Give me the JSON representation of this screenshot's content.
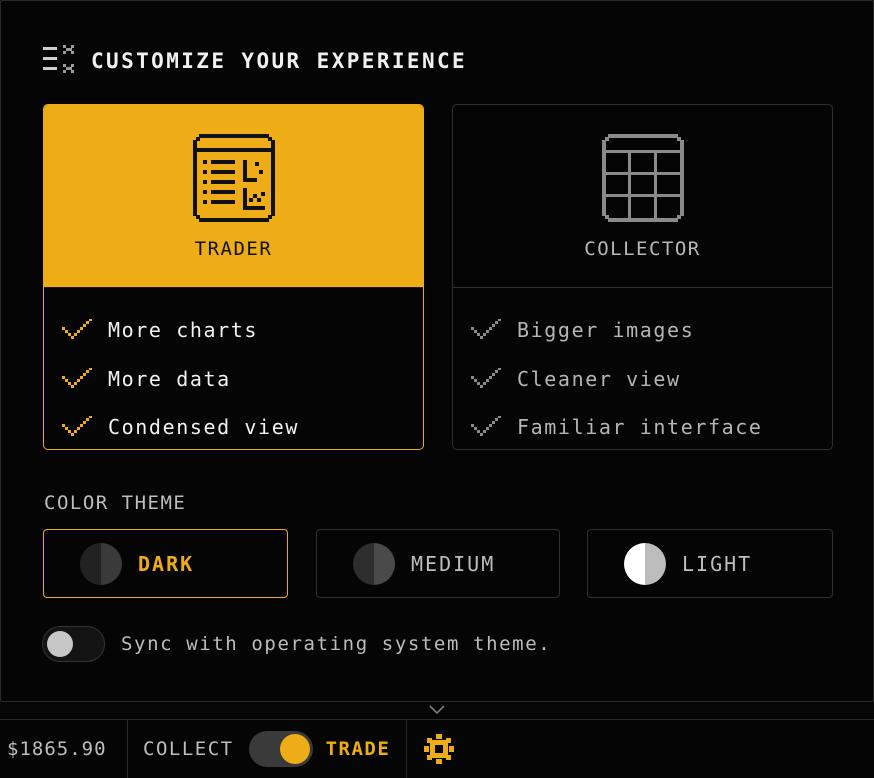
{
  "panel": {
    "title": "CUSTOMIZE YOUR EXPERIENCE",
    "title_icon": "customize-icon"
  },
  "modes": [
    {
      "label": "TRADER",
      "selected": true,
      "icon": "trader-dashboard-icon",
      "features": [
        "More charts",
        "More data",
        "Condensed view"
      ]
    },
    {
      "label": "COLLECTOR",
      "selected": false,
      "icon": "collector-grid-icon",
      "features": [
        "Bigger images",
        "Cleaner view",
        "Familiar interface"
      ]
    }
  ],
  "color_theme": {
    "label": "COLOR THEME",
    "options": [
      {
        "label": "DARK",
        "selected": true,
        "left": "#222222",
        "right": "#3a3a3a"
      },
      {
        "label": "MEDIUM",
        "selected": false,
        "left": "#2e2e2e",
        "right": "#4a4a4a"
      },
      {
        "label": "LIGHT",
        "selected": false,
        "left": "#ffffff",
        "right": "#bdbdbd"
      }
    ]
  },
  "sync": {
    "label": "Sync with operating system theme.",
    "enabled": false
  },
  "bottom_bar": {
    "balance": "$1865.90",
    "collect_label": "COLLECT",
    "trade_label": "TRADE",
    "mode_is_trade": true,
    "settings_icon": "gear-icon"
  },
  "colors": {
    "accent": "#eeac17",
    "background": "#050505",
    "border": "#2f2f2f",
    "muted_text": "#bdbdbd"
  }
}
